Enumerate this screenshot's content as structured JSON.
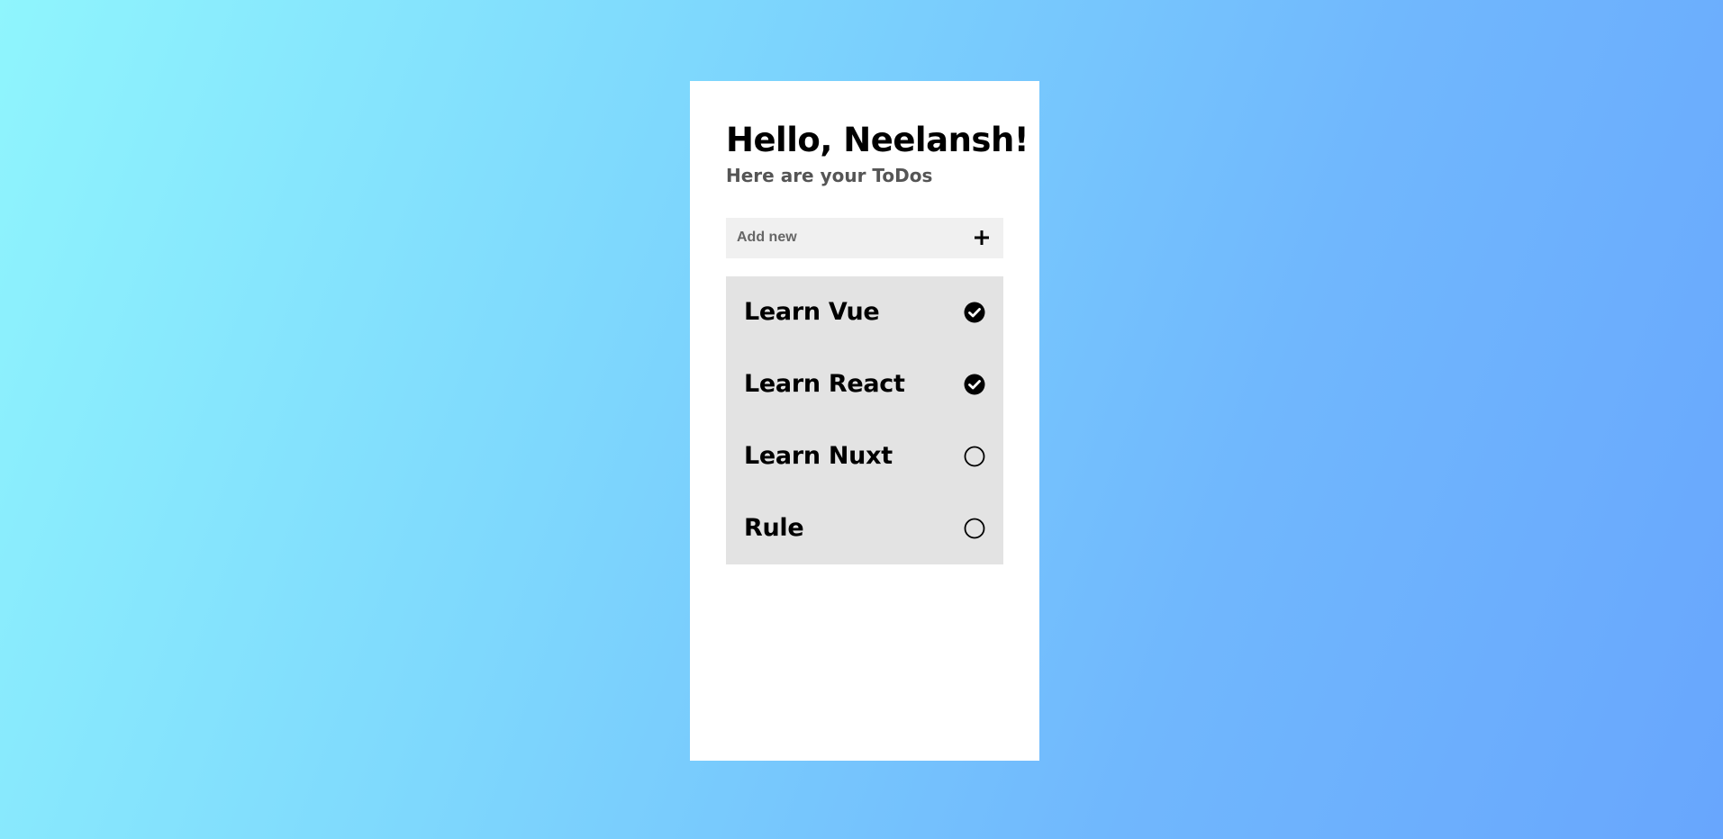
{
  "header": {
    "greeting": "Hello, Neelansh!",
    "subtitle": "Here are your ToDos"
  },
  "add_new": {
    "placeholder": "Add new",
    "value": "",
    "button_icon": "plus-icon"
  },
  "todos": [
    {
      "label": "Learn Vue",
      "done": true
    },
    {
      "label": "Learn React",
      "done": true
    },
    {
      "label": "Learn Nuxt",
      "done": false
    },
    {
      "label": "Rule",
      "done": false
    }
  ],
  "icons": {
    "done": "check-circle-icon",
    "pending": "empty-circle-icon"
  },
  "colors": {
    "background_start": "#8ff5fd",
    "background_end": "#68a6fd",
    "card": "#ffffff",
    "input_bg": "#f0f0f0",
    "list_bg": "#e3e3e3",
    "text": "#000000",
    "subtitle": "#555555"
  }
}
